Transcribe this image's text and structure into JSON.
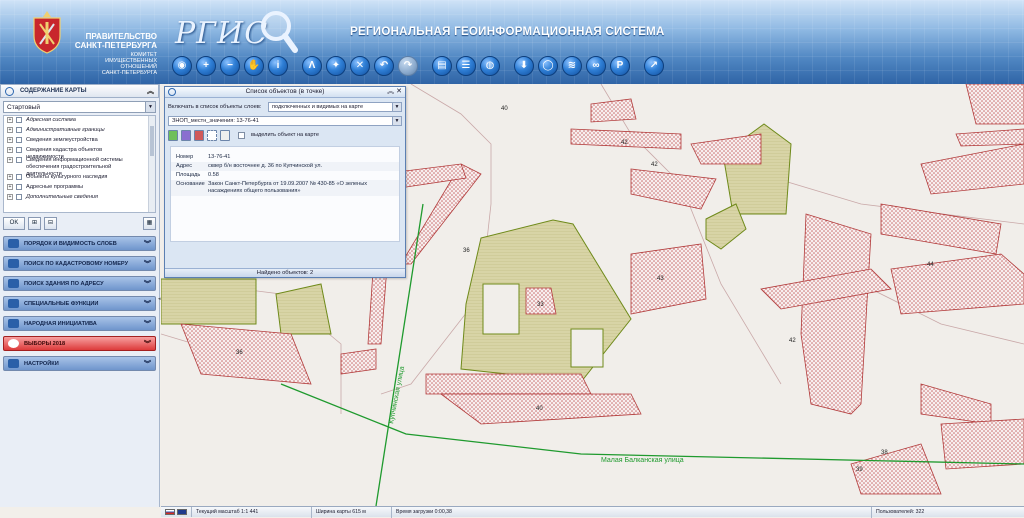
{
  "header": {
    "gov_name_line1": "ПРАВИТЕЛЬСТВО",
    "gov_name_line2": "САНКТ-ПЕТЕРБУРГА",
    "committee": [
      "КОМИТЕТ",
      "ИМУЩЕСТВЕННЫХ",
      "ОТНОШЕНИЙ",
      "САНКТ-ПЕТЕРБУРГА"
    ],
    "logo": "РГИС",
    "system_title": "РЕГИОНАЛЬНАЯ  ГЕОИНФОРМАЦИОННАЯ СИСТЕМА"
  },
  "toolbar": [
    {
      "icon": "pan-icon",
      "glyph": "◉",
      "state": "normal"
    },
    {
      "icon": "zoom-in-icon",
      "glyph": "+",
      "state": "normal"
    },
    {
      "icon": "zoom-out-icon",
      "glyph": "−",
      "state": "normal"
    },
    {
      "icon": "hand-icon",
      "glyph": "✋",
      "state": "normal"
    },
    {
      "icon": "info-icon",
      "glyph": "i",
      "state": "normal"
    },
    {
      "icon": "measure-icon",
      "glyph": "Λ",
      "state": "normal",
      "gap": true
    },
    {
      "icon": "area-icon",
      "glyph": "✦",
      "state": "normal"
    },
    {
      "icon": "clear-icon",
      "glyph": "✕",
      "state": "normal"
    },
    {
      "icon": "back-icon",
      "glyph": "↶",
      "state": "normal"
    },
    {
      "icon": "forward-icon",
      "glyph": "↷",
      "state": "dim"
    },
    {
      "icon": "print-icon",
      "glyph": "▤",
      "state": "normal",
      "gap": true
    },
    {
      "icon": "list-icon",
      "glyph": "☰",
      "state": "normal"
    },
    {
      "icon": "globe-icon",
      "glyph": "◍",
      "state": "normal"
    },
    {
      "icon": "download-icon",
      "glyph": "⬇",
      "state": "normal",
      "gap": true
    },
    {
      "icon": "comment-icon",
      "glyph": "◯",
      "state": "normal"
    },
    {
      "icon": "rss-icon",
      "glyph": "≋",
      "state": "normal"
    },
    {
      "icon": "link-icon",
      "glyph": "∞",
      "state": "normal"
    },
    {
      "icon": "parking-icon",
      "glyph": "P",
      "state": "normal"
    },
    {
      "icon": "export-icon",
      "glyph": "↗",
      "state": "normal",
      "gap": true
    }
  ],
  "sidebar": {
    "content_header": "СОДЕРЖАНИЕ КАРТЫ",
    "preset_select": "Стартовый",
    "layers": [
      {
        "label": "Адресная система",
        "italic": true,
        "expander": true
      },
      {
        "label": "Административные границы",
        "italic": true,
        "expander": true
      },
      {
        "label": "Сведения землеустройства",
        "italic": false,
        "expander": true
      },
      {
        "label": "Сведения кадастра объектов недвижимости",
        "italic": false,
        "expander": true
      },
      {
        "label": "Сведения информационной системы обеспечения градостроительной деятельности",
        "italic": false,
        "expander": true,
        "tall": true
      },
      {
        "label": "Объекты культурного наследия",
        "italic": false,
        "expander": true
      },
      {
        "label": "Адресные программы",
        "italic": false,
        "expander": true
      },
      {
        "label": "Дополнительные сведения",
        "italic": true,
        "expander": true
      }
    ],
    "ok_label": "OK",
    "accordions": [
      {
        "name": "acc-layer-order",
        "label": "ПОРЯДОК И ВИДИМОСТЬ СЛОЕВ",
        "icon": "layers-icon",
        "red": false
      },
      {
        "name": "acc-cadastral-search",
        "label": "ПОИСК ПО КАДАСТРОВОМУ НОМЕРУ",
        "icon": "cadastral-icon",
        "red": false
      },
      {
        "name": "acc-address-search",
        "label": "ПОИСК ЗДАНИЯ ПО АДРЕСУ",
        "icon": "building-icon",
        "red": false
      },
      {
        "name": "acc-special",
        "label": "СПЕЦИАЛЬНЫЕ ФУНКЦИИ",
        "icon": "gear-icon",
        "red": false
      },
      {
        "name": "acc-initiative",
        "label": "НАРОДНАЯ ИНИЦИАТИВА",
        "icon": "initiative-icon",
        "red": false
      },
      {
        "name": "acc-elections",
        "label": "ВЫБОРЫ 2018",
        "icon": "check-icon",
        "red": true
      },
      {
        "name": "acc-settings",
        "label": "НАСТРОЙКИ",
        "icon": "tools-icon",
        "red": false
      }
    ]
  },
  "popup": {
    "title": "Список объектов (в точке)",
    "include_label": "Включать в список объекты слоев:",
    "include_value": "подключенных и видимых на карте",
    "object_select": "ЗНОП_местн_значения: 13-76-41",
    "highlight_label": "выделить объект на карте",
    "fields": [
      {
        "label": "Номер",
        "value": "13-76-41"
      },
      {
        "label": "Адрес",
        "value": "сквер б/н восточнее д. 36 по Купчинской ул."
      },
      {
        "label": "Площадь",
        "value": "0.58"
      },
      {
        "label": "Основание",
        "value": "Закон Санкт-Петербурга от 19.09.2007 № 430-85 «О зеленых насаждениях общего пользования»"
      }
    ],
    "found": "Найдено объектов: 2"
  },
  "map": {
    "labels": [
      {
        "text": "42",
        "kind": "parcel"
      },
      {
        "text": "42",
        "kind": "parcel"
      },
      {
        "text": "42",
        "kind": "parcel"
      },
      {
        "text": "44",
        "kind": "parcel"
      },
      {
        "text": "36",
        "kind": "parcel"
      },
      {
        "text": "36",
        "kind": "parcel"
      },
      {
        "text": "40",
        "kind": "parcel"
      },
      {
        "text": "40",
        "kind": "parcel"
      },
      {
        "text": "43",
        "kind": "parcel"
      },
      {
        "text": "39",
        "kind": "parcel"
      },
      {
        "text": "38",
        "kind": "parcel"
      },
      {
        "text": "33",
        "kind": "parcel"
      }
    ],
    "streets": [
      "Купчинская улица",
      "Малая Балканская улица"
    ],
    "colors": {
      "parcel": "#b23b3b",
      "green": "#d6d3a3",
      "green_edge": "#6f8a1a",
      "street": "#1f9a2e",
      "ground": "#f1eeea"
    }
  },
  "status": {
    "scale": "Текущий масштаб 1:1 441",
    "width": "Ширина карты 615 м",
    "load_time": "Время загрузки 0:00,38",
    "users": "Пользователей: 322"
  }
}
